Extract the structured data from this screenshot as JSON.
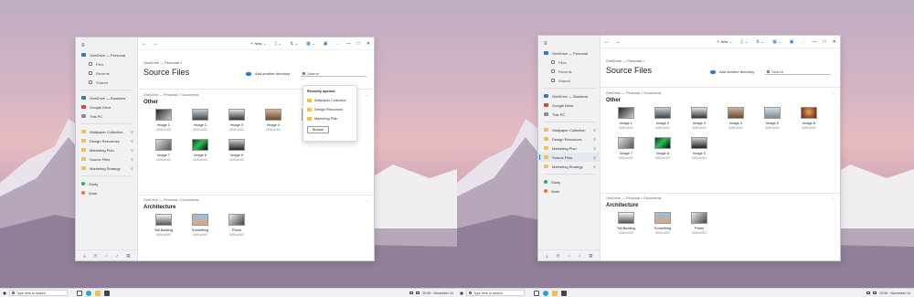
{
  "taskbar": {
    "search_placeholder": "Type here to search",
    "time": "20:59",
    "date": "November 14"
  },
  "colors": {
    "accent": "#2b7cd3",
    "folder": "#f2c04b",
    "onedrive": "#2b7cd3",
    "google_drive": "#e34133",
    "study": "#2fae5b",
    "work": "#e8792b"
  },
  "window": {
    "nav": {
      "back_icon": "arrow-left-icon",
      "forward_icon": "arrow-right-icon"
    },
    "toolbar": {
      "new_label": "New",
      "more_label": "..."
    },
    "sidebar": {
      "menu_icon": "hamburger-icon",
      "items": [
        {
          "label": "OneDrive — Personal",
          "icon": "cloud-icon"
        },
        {
          "label": "Files",
          "icon": "files-icon"
        },
        {
          "label": "Recents",
          "icon": "clock-icon"
        },
        {
          "label": "Shared",
          "icon": "share-icon"
        },
        {
          "label": "OneDrive — Business",
          "icon": "cloud-icon"
        },
        {
          "label": "Google Drive",
          "icon": "drive-icon"
        },
        {
          "label": "This PC",
          "icon": "pc-icon"
        },
        {
          "label": "Wallpaper Collection",
          "icon": "folder-icon"
        },
        {
          "label": "Design Resources",
          "icon": "folder-icon"
        },
        {
          "label": "Marketing Plan",
          "icon": "folder-icon"
        },
        {
          "label": "Source Files",
          "icon": "folder-icon"
        },
        {
          "label": "Marketing Strategy",
          "icon": "folder-icon"
        },
        {
          "label": "Study",
          "icon": "tag-icon"
        },
        {
          "label": "Work",
          "icon": "tag-icon"
        }
      ]
    },
    "breadcrumb_top": "OneDrive — Personal   >",
    "page_title": "Source Files",
    "add_directory_label": "Add another directory",
    "search_placeholder": "Search",
    "sections": [
      {
        "breadcrumb": "OneDrive — Personal   >   Documents",
        "title": "Other",
        "more": "...",
        "tiles": [
          {
            "name": "Image 1",
            "size": "6000x4000"
          },
          {
            "name": "Image 2",
            "size": "6000x4000"
          },
          {
            "name": "Image 3",
            "size": "6000x4000"
          },
          {
            "name": "Image 4",
            "size": "6000x4000"
          },
          {
            "name": "Image 5",
            "size": "6000x4000"
          },
          {
            "name": "Image 6",
            "size": "6000x4000"
          },
          {
            "name": "Image 7",
            "size": "6000x4000"
          },
          {
            "name": "Image 8",
            "size": "6000x4000"
          },
          {
            "name": "Image 9",
            "size": "6000x4000"
          }
        ]
      },
      {
        "breadcrumb": "OneDrive — Personal   >   Documents",
        "title": "Architecture",
        "more": "...",
        "tiles": [
          {
            "name": "Tall Building",
            "size": "6000x4000"
          },
          {
            "name": "Something",
            "size": "6000x4000"
          },
          {
            "name": "Photo",
            "size": "6000x4000"
          }
        ]
      }
    ],
    "popup": {
      "heading": "Recently opened",
      "items": [
        "Wallpaper Collection",
        "Design Resources",
        "Marketing Plan"
      ],
      "button": "Browse"
    }
  }
}
